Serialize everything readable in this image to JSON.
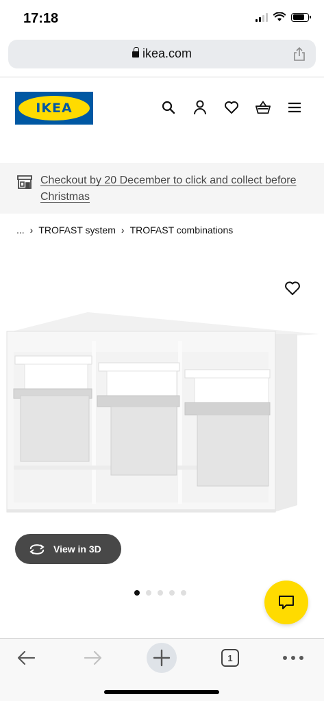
{
  "status_bar": {
    "time": "17:18"
  },
  "browser": {
    "url": "ikea.com"
  },
  "header": {
    "logo_text": "IKEA",
    "icons": [
      "search-icon",
      "account-icon",
      "favourites-icon",
      "basket-icon",
      "menu-icon"
    ]
  },
  "banner": {
    "text": "Checkout by 20 December to click and collect before Christmas"
  },
  "breadcrumb": {
    "ellipsis": "...",
    "items": [
      "TROFAST system",
      "TROFAST combinations"
    ]
  },
  "product": {
    "view3d_label": "View in 3D",
    "image_count": 5,
    "active_image": 0
  },
  "toolbar": {
    "tab_count": "1"
  },
  "colors": {
    "ikea_blue": "#0058a3",
    "ikea_yellow": "#ffdb00",
    "dark_button": "#484848"
  }
}
